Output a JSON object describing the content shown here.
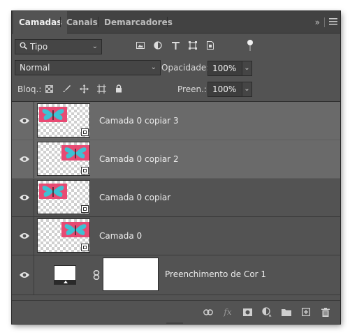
{
  "tabs": [
    {
      "label": "Camadas",
      "active": true
    },
    {
      "label": "Canais",
      "active": false
    },
    {
      "label": "Demarcadores",
      "active": false
    }
  ],
  "tabbar_icons": [
    "collapse-arrows-icon",
    "panel-menu-icon"
  ],
  "filter": {
    "kind_label": "Tipo",
    "icons": [
      "pixel-layer-filter-icon",
      "adjustment-layer-filter-icon",
      "type-layer-filter-icon",
      "shape-layer-filter-icon",
      "smart-object-filter-icon"
    ]
  },
  "blend": {
    "mode": "Normal",
    "opacity_label": "Opacidade:",
    "opacity_value": "100%"
  },
  "lock": {
    "label": "Bloq.:",
    "icons": [
      "lock-transparent-pixels-icon",
      "lock-image-pixels-icon",
      "lock-position-icon",
      "lock-artboard-icon",
      "lock-all-icon"
    ],
    "fill_label": "Preen.:",
    "fill_value": "100%"
  },
  "layers": [
    {
      "name": "Camada 0 copiar 3",
      "selected": true,
      "butterfly_position": "left"
    },
    {
      "name": "Camada 0 copiar 2",
      "selected": true,
      "butterfly_position": "right"
    },
    {
      "name": "Camada 0 copiar",
      "selected": false,
      "butterfly_position": "left"
    },
    {
      "name": "Camada 0",
      "selected": false,
      "butterfly_position": "right"
    }
  ],
  "fill_layer": {
    "name": "Preenchimento de Cor 1"
  },
  "footer_icons": [
    "link-layers-icon",
    "layer-style-fx-icon",
    "add-mask-icon",
    "new-adjustment-layer-icon",
    "new-group-folder-icon",
    "new-layer-icon",
    "delete-layer-icon"
  ],
  "colors": {
    "panel_bg": "#535353",
    "selected_row": "#6a6a6a",
    "butterfly_pink": "#e84a73",
    "butterfly_cyan": "#3ec1d3"
  }
}
